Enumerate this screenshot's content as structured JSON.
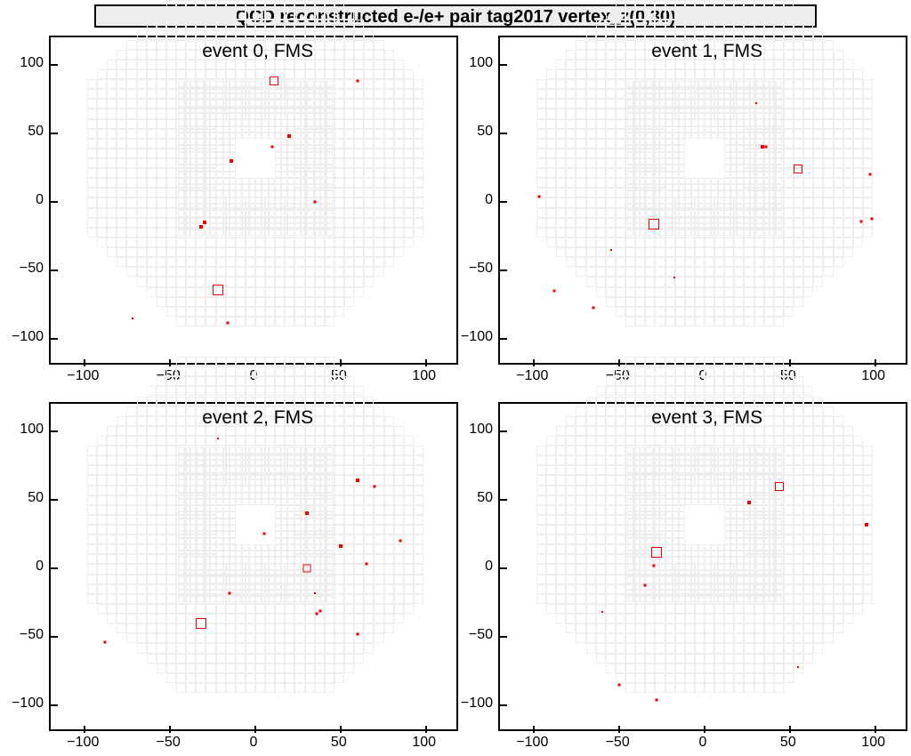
{
  "title": "QCD reconstructed e-/e+ pair tag2017 vertex_z(0,30)",
  "axis": {
    "min": -120,
    "max": 120,
    "ticks": [
      -100,
      -50,
      0,
      50,
      100
    ]
  },
  "panels": [
    {
      "subtitle": "event 0, FMS"
    },
    {
      "subtitle": "event 1, FMS"
    },
    {
      "subtitle": "event 2, FMS"
    },
    {
      "subtitle": "event 3, FMS"
    }
  ],
  "chart_data": [
    {
      "type": "scatter",
      "title": "event 0, FMS",
      "xlabel": "",
      "ylabel": "",
      "xlim": [
        -120,
        120
      ],
      "ylim": [
        -120,
        120
      ],
      "hits": [
        {
          "x": 11,
          "y": 88,
          "size": 10,
          "style": "open"
        },
        {
          "x": -22,
          "y": -64,
          "size": 12,
          "style": "open"
        },
        {
          "x": 60,
          "y": 88,
          "size": 3,
          "style": "fill"
        },
        {
          "x": 20,
          "y": 48,
          "size": 4,
          "style": "fill"
        },
        {
          "x": 10,
          "y": 40,
          "size": 3,
          "style": "fill"
        },
        {
          "x": -14,
          "y": 30,
          "size": 4,
          "style": "fill"
        },
        {
          "x": 35,
          "y": 0,
          "size": 3,
          "style": "fill"
        },
        {
          "x": -30,
          "y": -15,
          "size": 4,
          "style": "fill"
        },
        {
          "x": -32,
          "y": -18,
          "size": 4,
          "style": "fill"
        },
        {
          "x": -16,
          "y": -88,
          "size": 3,
          "style": "fill"
        },
        {
          "x": -72,
          "y": -85,
          "size": 2,
          "style": "fill"
        }
      ]
    },
    {
      "type": "scatter",
      "title": "event 1, FMS",
      "xlabel": "",
      "ylabel": "",
      "xlim": [
        -120,
        120
      ],
      "ylim": [
        -120,
        120
      ],
      "hits": [
        {
          "x": -30,
          "y": -16,
          "size": 12,
          "style": "open"
        },
        {
          "x": 55,
          "y": 24,
          "size": 10,
          "style": "open"
        },
        {
          "x": 30,
          "y": 72,
          "size": 2,
          "style": "fill"
        },
        {
          "x": 34,
          "y": 40,
          "size": 4,
          "style": "fill"
        },
        {
          "x": 36,
          "y": 40,
          "size": 3,
          "style": "fill"
        },
        {
          "x": 97,
          "y": 20,
          "size": 3,
          "style": "fill"
        },
        {
          "x": -97,
          "y": 4,
          "size": 3,
          "style": "fill"
        },
        {
          "x": 98,
          "y": -12,
          "size": 3,
          "style": "fill"
        },
        {
          "x": 92,
          "y": -14,
          "size": 3,
          "style": "fill"
        },
        {
          "x": -55,
          "y": -35,
          "size": 2,
          "style": "fill"
        },
        {
          "x": -18,
          "y": -55,
          "size": 2,
          "style": "fill"
        },
        {
          "x": -88,
          "y": -65,
          "size": 3,
          "style": "fill"
        },
        {
          "x": -65,
          "y": -77,
          "size": 3,
          "style": "fill"
        }
      ]
    },
    {
      "type": "scatter",
      "title": "event 2, FMS",
      "xlabel": "",
      "ylabel": "",
      "xlim": [
        -120,
        120
      ],
      "ylim": [
        -120,
        120
      ],
      "hits": [
        {
          "x": -32,
          "y": -40,
          "size": 12,
          "style": "open"
        },
        {
          "x": 30,
          "y": 0,
          "size": 9,
          "style": "open"
        },
        {
          "x": -22,
          "y": 95,
          "size": 2,
          "style": "fill"
        },
        {
          "x": 60,
          "y": 64,
          "size": 4,
          "style": "fill"
        },
        {
          "x": 70,
          "y": 60,
          "size": 3,
          "style": "fill"
        },
        {
          "x": 30,
          "y": 40,
          "size": 4,
          "style": "fill"
        },
        {
          "x": 5,
          "y": 25,
          "size": 3,
          "style": "fill"
        },
        {
          "x": 85,
          "y": 20,
          "size": 3,
          "style": "fill"
        },
        {
          "x": 50,
          "y": 16,
          "size": 4,
          "style": "fill"
        },
        {
          "x": 65,
          "y": 3,
          "size": 3,
          "style": "fill"
        },
        {
          "x": -15,
          "y": -18,
          "size": 3,
          "style": "fill"
        },
        {
          "x": 35,
          "y": -18,
          "size": 2,
          "style": "fill"
        },
        {
          "x": 38,
          "y": -31,
          "size": 3,
          "style": "fill"
        },
        {
          "x": 36,
          "y": -33,
          "size": 3,
          "style": "fill"
        },
        {
          "x": 60,
          "y": -48,
          "size": 3,
          "style": "fill"
        },
        {
          "x": -88,
          "y": -54,
          "size": 3,
          "style": "fill"
        }
      ]
    },
    {
      "type": "scatter",
      "title": "event 3, FMS",
      "xlabel": "",
      "ylabel": "",
      "xlim": [
        -120,
        120
      ],
      "ylim": [
        -120,
        120
      ],
      "hits": [
        {
          "x": -28,
          "y": 12,
          "size": 12,
          "style": "open"
        },
        {
          "x": 44,
          "y": 60,
          "size": 10,
          "style": "open"
        },
        {
          "x": 26,
          "y": 48,
          "size": 4,
          "style": "fill"
        },
        {
          "x": 95,
          "y": 32,
          "size": 4,
          "style": "fill"
        },
        {
          "x": -30,
          "y": 2,
          "size": 3,
          "style": "fill"
        },
        {
          "x": -35,
          "y": -12,
          "size": 3,
          "style": "fill"
        },
        {
          "x": -60,
          "y": -32,
          "size": 2,
          "style": "fill"
        },
        {
          "x": 55,
          "y": -72,
          "size": 2,
          "style": "fill"
        },
        {
          "x": -50,
          "y": -85,
          "size": 3,
          "style": "fill"
        },
        {
          "x": -28,
          "y": -96,
          "size": 3,
          "style": "fill"
        }
      ]
    }
  ]
}
